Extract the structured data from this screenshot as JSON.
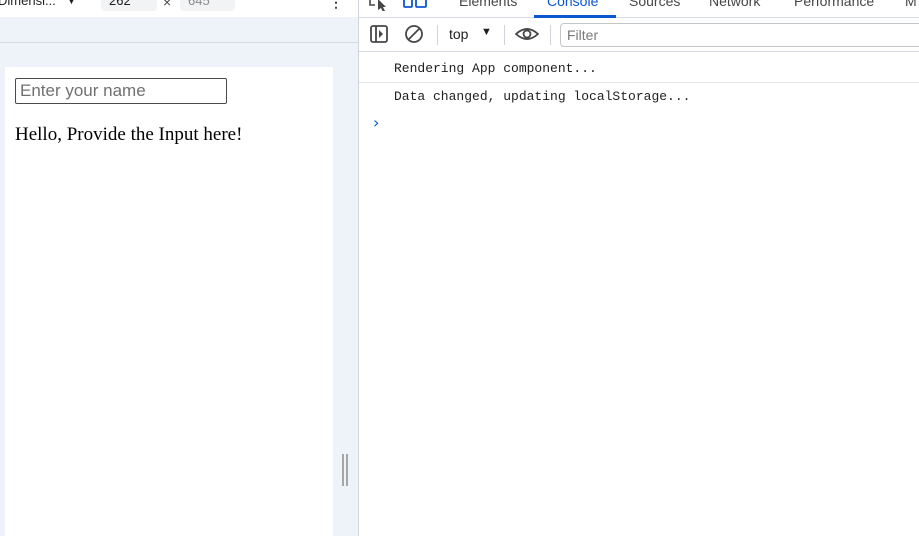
{
  "device_toolbar": {
    "dimensions_label": "Dimensi...",
    "width_value": "262",
    "height_value": "645"
  },
  "page": {
    "input_placeholder": "Enter your name",
    "greeting": "Hello, Provide the Input here!"
  },
  "devtools": {
    "tabs": [
      {
        "label": "Elements",
        "active": false
      },
      {
        "label": "Console",
        "active": true
      },
      {
        "label": "Sources",
        "active": false
      },
      {
        "label": "Network",
        "active": false
      },
      {
        "label": "Performance",
        "active": false
      },
      {
        "label": "M",
        "active": false
      }
    ],
    "context": "top",
    "filter_placeholder": "Filter",
    "messages": [
      "Rendering App component...",
      "Data changed, updating localStorage..."
    ]
  },
  "colors": {
    "accent": "#0b57d0",
    "pane_bg": "#eef2f9"
  }
}
